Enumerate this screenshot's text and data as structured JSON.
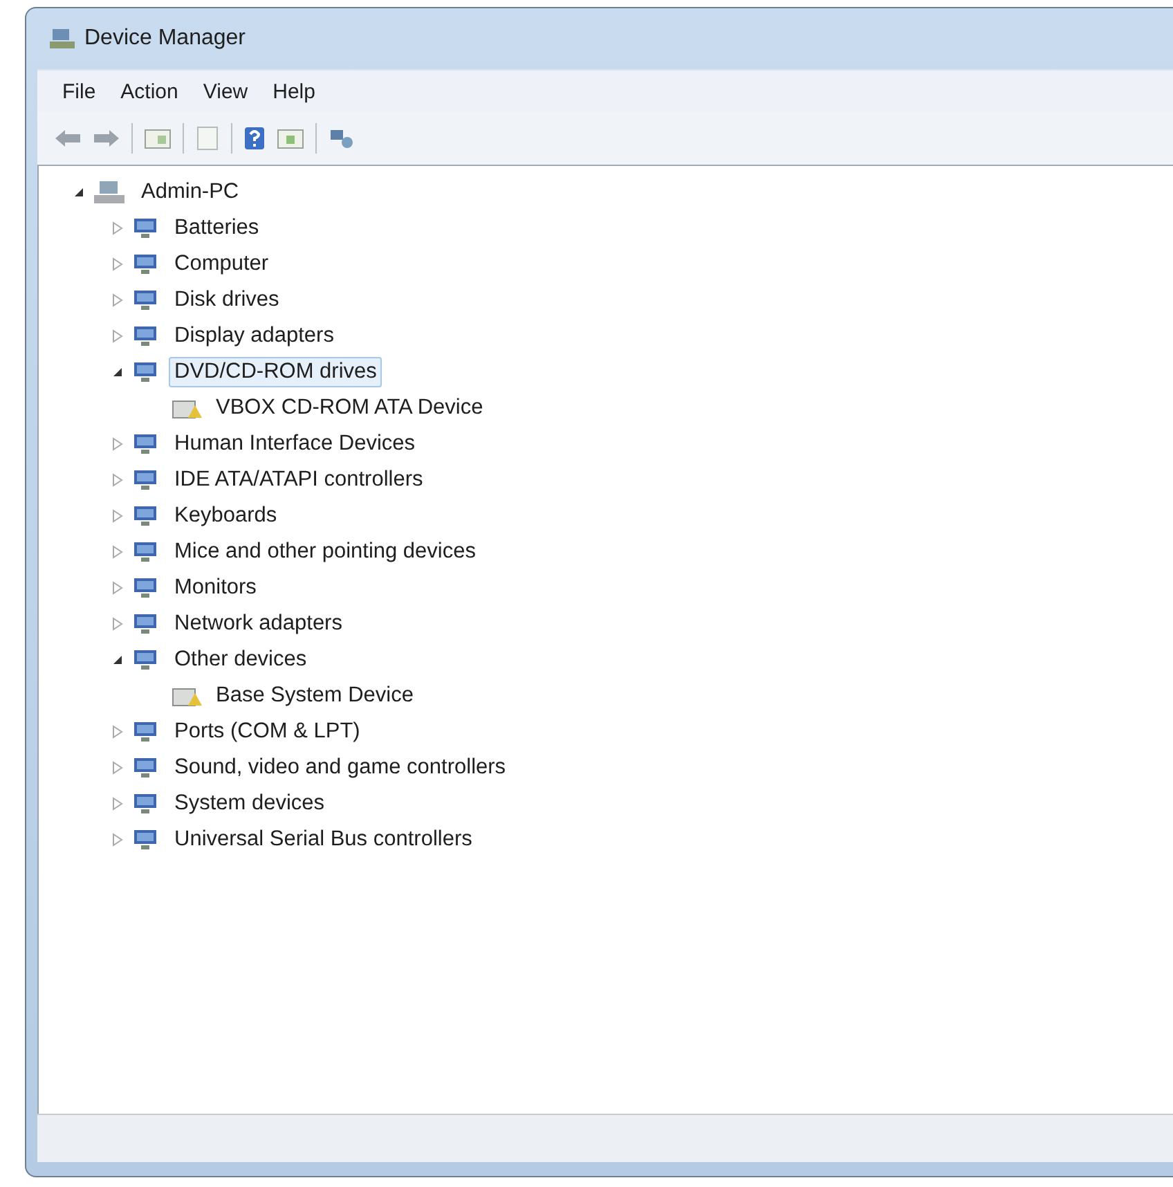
{
  "window": {
    "title": "Device Manager"
  },
  "menu": [
    "File",
    "Action",
    "View",
    "Help"
  ],
  "tree": {
    "label": "Admin-PC",
    "expanded": true,
    "selected": false,
    "children": [
      {
        "label": "Batteries",
        "expanded": false,
        "selected": false
      },
      {
        "label": "Computer",
        "expanded": false,
        "selected": false
      },
      {
        "label": "Disk drives",
        "expanded": false,
        "selected": false
      },
      {
        "label": "Display adapters",
        "expanded": false,
        "selected": false
      },
      {
        "label": "DVD/CD-ROM drives",
        "expanded": true,
        "selected": true,
        "children": [
          {
            "label": "VBOX CD-ROM ATA Device",
            "selected": false
          }
        ]
      },
      {
        "label": "Human Interface Devices",
        "expanded": false,
        "selected": false
      },
      {
        "label": "IDE ATA/ATAPI controllers",
        "expanded": false,
        "selected": false
      },
      {
        "label": "Keyboards",
        "expanded": false,
        "selected": false
      },
      {
        "label": "Mice and other pointing devices",
        "expanded": false,
        "selected": false
      },
      {
        "label": "Monitors",
        "expanded": false,
        "selected": false
      },
      {
        "label": "Network adapters",
        "expanded": false,
        "selected": false
      },
      {
        "label": "Other devices",
        "expanded": true,
        "selected": false,
        "children": [
          {
            "label": "Base System Device",
            "selected": false
          }
        ]
      },
      {
        "label": "Ports (COM & LPT)",
        "expanded": false,
        "selected": false
      },
      {
        "label": "Sound, video and game controllers",
        "expanded": false,
        "selected": false
      },
      {
        "label": "System devices",
        "expanded": false,
        "selected": false
      },
      {
        "label": "Universal Serial Bus controllers",
        "expanded": false,
        "selected": false
      }
    ]
  }
}
